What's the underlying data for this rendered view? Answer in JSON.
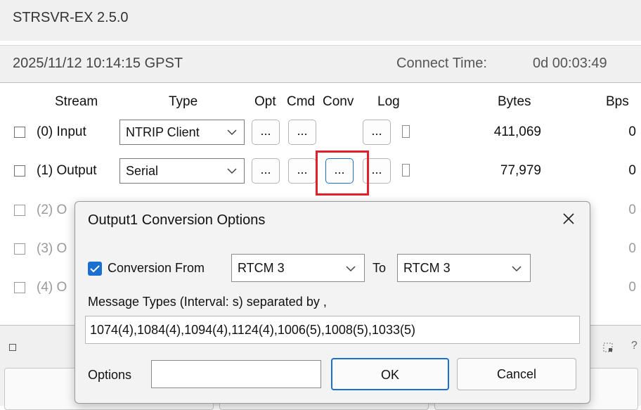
{
  "app": {
    "title": "STRSVR-EX 2.5.0"
  },
  "status": {
    "time": "2025/11/12 10:14:15 GPST",
    "connect_label": "Connect Time:",
    "connect_value": "0d 00:03:49"
  },
  "table": {
    "headers": {
      "stream": "Stream",
      "type": "Type",
      "opt": "Opt",
      "cmd": "Cmd",
      "conv": "Conv",
      "log": "Log",
      "bytes": "Bytes",
      "bps": "Bps"
    },
    "rows": [
      {
        "label": "(0) Input",
        "type": "NTRIP Client",
        "bytes": "411,069",
        "bps": "0"
      },
      {
        "label": "(1) Output",
        "type": "Serial",
        "bytes": "77,979",
        "bps": "0"
      },
      {
        "label": "(2) O",
        "bps": "0"
      },
      {
        "label": "(3) O",
        "bps": "0"
      },
      {
        "label": "(4) O",
        "bps": "0"
      }
    ],
    "button_label": "..."
  },
  "bottom": {
    "help_symbol": "?"
  },
  "dialog": {
    "title": "Output1 Conversion Options",
    "conversion_from_label": "Conversion From",
    "conversion_checked": true,
    "from_value": "RTCM 3",
    "to_label": "To",
    "to_value": "RTCM 3",
    "message_types_label": "Message Types  (Interval: s) separated by ,",
    "message_types_value": "1074(4),1084(4),1094(4),1124(4),1006(5),1008(5),1033(5)",
    "options_label": "Options",
    "options_value": "",
    "ok_label": "OK",
    "cancel_label": "Cancel"
  },
  "colors": {
    "highlight": "#e0202a",
    "accent": "#1a6fd1"
  }
}
